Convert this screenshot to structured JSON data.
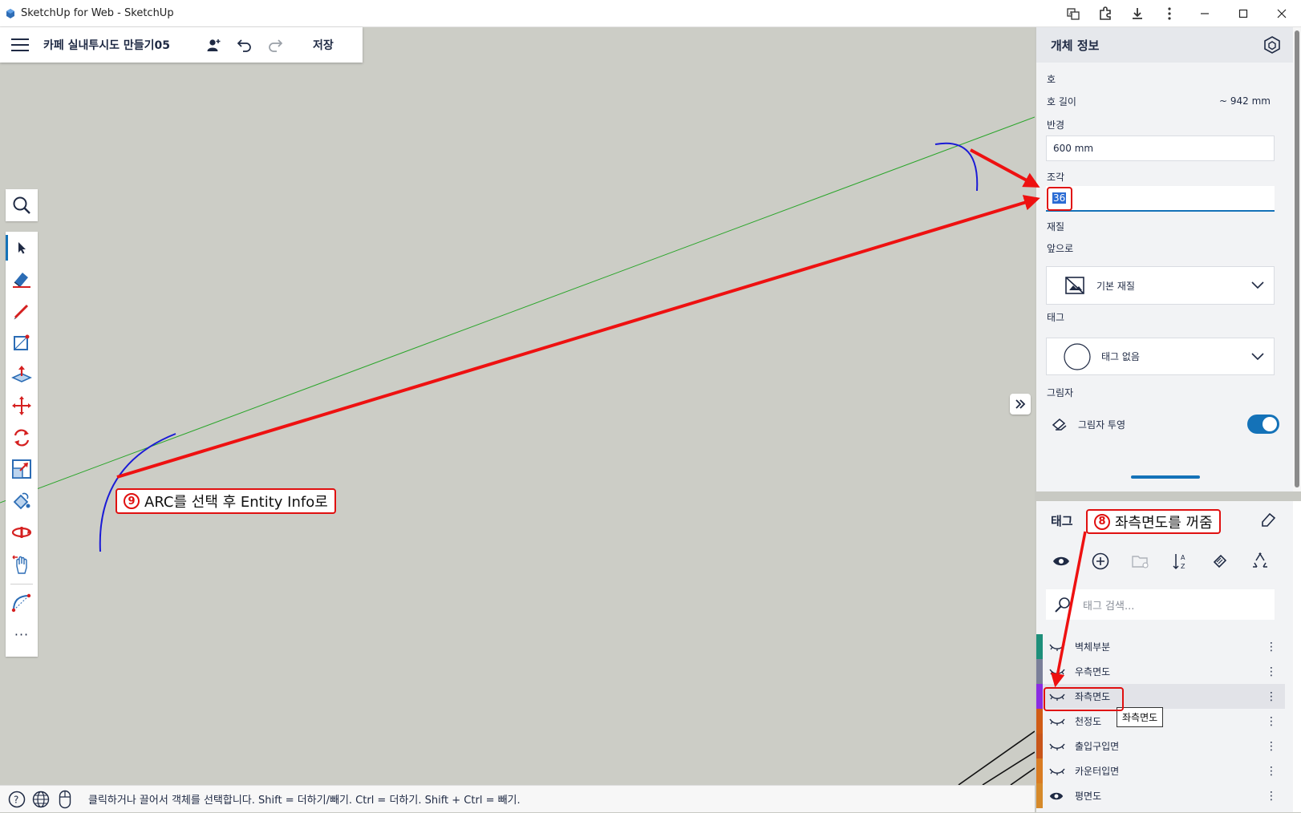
{
  "window": {
    "title": "SketchUp for Web - SketchUp",
    "controls": [
      "translate-icon",
      "extensions-icon",
      "download-icon",
      "more-vertical-icon",
      "minimize-icon",
      "maximize-icon",
      "close-icon"
    ]
  },
  "toolbar": {
    "doc_title": "카페 실내투시도 만들기05",
    "save_label": "저장"
  },
  "tools": [
    "search-icon",
    "select-icon",
    "eraser-icon",
    "pencil-icon",
    "rectangle-icon",
    "push-pull-icon",
    "move-icon",
    "rotate-icon",
    "scale-icon",
    "paint-bucket-icon",
    "orbit-icon",
    "pan-icon",
    "arc-icon",
    "more-icon"
  ],
  "more_label": "···",
  "entity_info": {
    "title": "개체 정보",
    "entity_type": "호",
    "arc_length_label": "호 길이",
    "arc_length_value": "~ 942 mm",
    "radius_label": "반경",
    "radius_value": "600 mm",
    "segments_label": "조각",
    "segments_value": "36",
    "material_label": "재질",
    "front_label": "앞으로",
    "material_value": "기본 재질",
    "tag_label": "태그",
    "tag_value": "태그 없음",
    "shadow_label": "그림자",
    "shadow_cast_label": "그림자 투영",
    "shadow_cast_on": true
  },
  "tags": {
    "title": "태그",
    "search_placeholder": "태그 검색...",
    "tooltip": "좌측면도",
    "items": [
      {
        "name": "벽체부분",
        "color": "#1e8f7a",
        "visible": false
      },
      {
        "name": "우측면도",
        "color": "#7a7f99",
        "visible": false
      },
      {
        "name": "좌측면도",
        "color": "#8a2be2",
        "visible": false
      },
      {
        "name": "천정도",
        "color": "#d05c16",
        "visible": false
      },
      {
        "name": "출입구입면",
        "color": "#c8561a",
        "visible": false
      },
      {
        "name": "카운터입면",
        "color": "#d97c22",
        "visible": false
      },
      {
        "name": "평면도",
        "color": "#d68a2a",
        "visible": true
      }
    ]
  },
  "status": {
    "text": "클릭하거나 끌어서 객체를 선택합니다. Shift = 더하기/빼기. Ctrl = 더하기. Shift + Ctrl = 빼기."
  },
  "annotations": {
    "callout_9_num": "9",
    "callout_9_text": "ARC를 선택 후 Entity Info로",
    "callout_8_num": "8",
    "callout_8_text": "좌측면도를 꺼줌",
    "arrow_color": "#ee1111"
  }
}
